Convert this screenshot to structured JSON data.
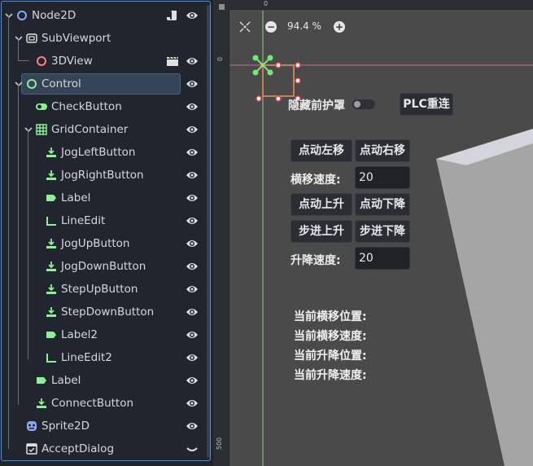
{
  "scene_tree": {
    "nodes": [
      {
        "label": "Node2D",
        "icon": "node2d-icon",
        "color": "#8da5f3",
        "depth": 0,
        "expanded": true,
        "extra": "script-icon",
        "eye": true
      },
      {
        "label": "SubViewport",
        "icon": "subviewport-icon",
        "color": "#e0e0e0",
        "depth": 1,
        "expanded": true,
        "eye": false
      },
      {
        "label": "3DView",
        "icon": "node3d-icon",
        "color": "#fc7f7f",
        "depth": 2,
        "extra": "clapper-icon",
        "eye": true
      },
      {
        "label": "Control",
        "icon": "control-icon",
        "color": "#8eef97",
        "depth": 1,
        "expanded": true,
        "selected": true,
        "eye": true
      },
      {
        "label": "CheckButton",
        "icon": "check-button-icon",
        "color": "#8eef97",
        "depth": 2,
        "eye": true
      },
      {
        "label": "GridContainer",
        "icon": "grid-container-icon",
        "color": "#8eef97",
        "depth": 2,
        "expanded": true,
        "eye": true
      },
      {
        "label": "JogLeftButton",
        "icon": "button-icon",
        "color": "#8eef97",
        "depth": 3,
        "eye": true
      },
      {
        "label": "JogRightButton",
        "icon": "button-icon",
        "color": "#8eef97",
        "depth": 3,
        "eye": true
      },
      {
        "label": "Label",
        "icon": "label-icon",
        "color": "#8eef97",
        "depth": 3,
        "eye": true
      },
      {
        "label": "LineEdit",
        "icon": "line-edit-icon",
        "color": "#8eef97",
        "depth": 3,
        "eye": true
      },
      {
        "label": "JogUpButton",
        "icon": "button-icon",
        "color": "#8eef97",
        "depth": 3,
        "eye": true
      },
      {
        "label": "JogDownButton",
        "icon": "button-icon",
        "color": "#8eef97",
        "depth": 3,
        "eye": true
      },
      {
        "label": "StepUpButton",
        "icon": "button-icon",
        "color": "#8eef97",
        "depth": 3,
        "eye": true
      },
      {
        "label": "StepDownButton",
        "icon": "button-icon",
        "color": "#8eef97",
        "depth": 3,
        "eye": true
      },
      {
        "label": "Label2",
        "icon": "label-icon",
        "color": "#8eef97",
        "depth": 3,
        "eye": true
      },
      {
        "label": "LineEdit2",
        "icon": "line-edit-icon",
        "color": "#8eef97",
        "depth": 3,
        "eye": true
      },
      {
        "label": "Label",
        "icon": "label-icon",
        "color": "#8eef97",
        "depth": 2,
        "eye": true
      },
      {
        "label": "ConnectButton",
        "icon": "button-icon",
        "color": "#8eef97",
        "depth": 2,
        "eye": true
      },
      {
        "label": "Sprite2D",
        "icon": "sprite2d-icon",
        "color": "#8da5f3",
        "depth": 1,
        "eye": true
      },
      {
        "label": "AcceptDialog",
        "icon": "accept-dialog-icon",
        "color": "#e0e0e0",
        "depth": 1,
        "eye": false,
        "collapsed_eye": true
      }
    ]
  },
  "viewport": {
    "zoom_out_label": "−",
    "zoom_level": "94.4 %",
    "zoom_in_label": "+",
    "ruler_top_zero": "0",
    "ruler_left_zero": "0",
    "ruler_left_500": "500"
  },
  "game_ui": {
    "hide_cover_label": "隐藏前护罩",
    "plc_reconnect": "PLC重连",
    "jog_left": "点动左移",
    "jog_right": "点动右移",
    "traverse_speed_label": "横移速度:",
    "traverse_speed_value": "20",
    "jog_up": "点动上升",
    "jog_down": "点动下降",
    "step_up": "步进上升",
    "step_down": "步进下降",
    "lift_speed_label": "升降速度:",
    "lift_speed_value": "20",
    "status": [
      "当前横移位置:",
      "当前横移速度:",
      "当前升降位置:",
      "当前升降速度:"
    ]
  },
  "colors": {
    "selection": "#354457",
    "panel_border": "#4f8ee5",
    "control_green": "#8eef97",
    "node2d_blue": "#8da5f3"
  }
}
